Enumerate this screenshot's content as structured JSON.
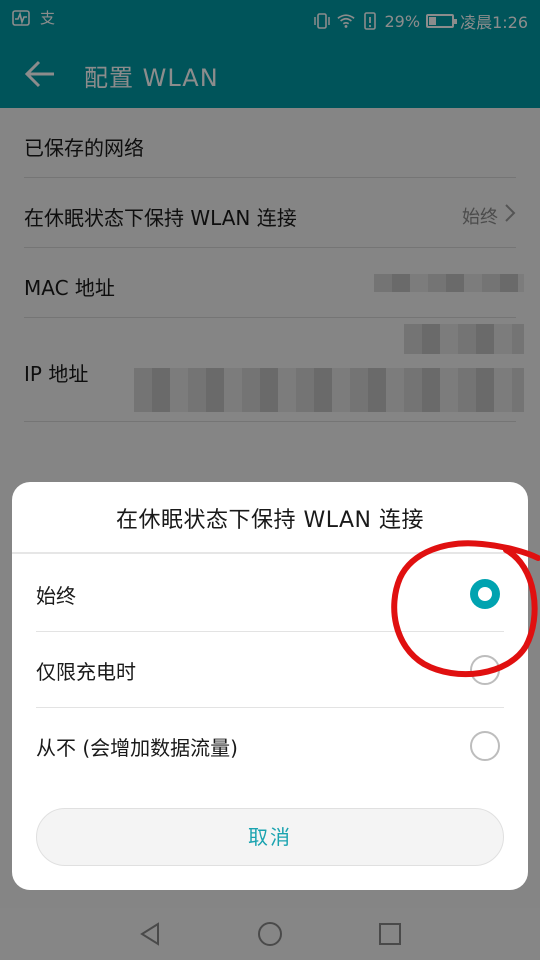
{
  "status_bar": {
    "left_icons": [
      "pulse-icon",
      "notification-icon"
    ],
    "battery_percent": "29%",
    "battery_level": 0.29,
    "time": "凌晨1:26"
  },
  "app_bar": {
    "title": "配置 WLAN"
  },
  "settings": {
    "saved_networks": "已保存的网络",
    "keep_wlan_label": "在休眠状态下保持 WLAN 连接",
    "keep_wlan_value": "始终",
    "mac_label": "MAC 地址",
    "ip_label": "IP 地址"
  },
  "dialog": {
    "title": "在休眠状态下保持 WLAN 连接",
    "options": [
      {
        "label": "始终",
        "selected": true
      },
      {
        "label": "仅限充电时",
        "selected": false
      },
      {
        "label": "从不 (会增加数据流量)",
        "selected": false
      }
    ],
    "cancel_label": "取消"
  },
  "colors": {
    "accent": "#009aa5",
    "radio_checked": "#00a3b0",
    "annotation": "#e01010"
  }
}
